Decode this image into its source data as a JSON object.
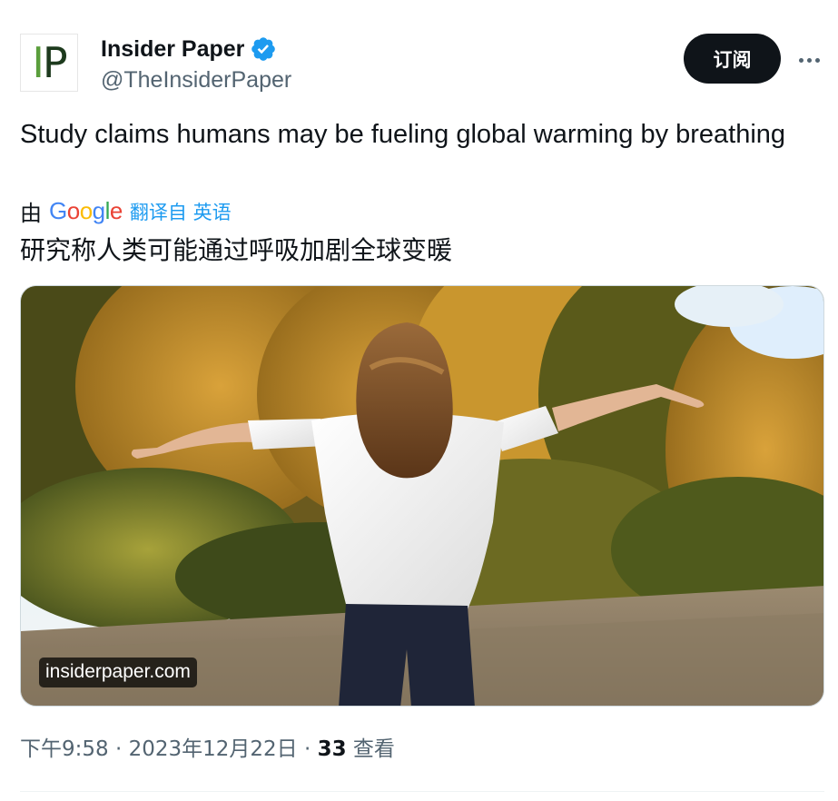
{
  "author": {
    "avatar_text": "IP",
    "display_name": "Insider Paper",
    "handle": "@TheInsiderPaper",
    "verified": true
  },
  "actions": {
    "subscribe_label": "订阅",
    "more_icon": "more-horizontal-icon"
  },
  "tweet": {
    "text": "Study claims humans may be fueling global warming by breathing",
    "translation": {
      "by_label": "由",
      "provider": "Google",
      "translated_from": "翻译自 英语",
      "text": "研究称人类可能通过呼吸加剧全球变暖"
    },
    "media": {
      "link_label": "insiderpaper.com",
      "alt": "Woman with outstretched arms in an autumn field"
    }
  },
  "meta": {
    "time": "下午9:58",
    "date": "2023年12月22日",
    "separator": " · ",
    "views_count": "33",
    "views_label": " 查看"
  },
  "colors": {
    "accent": "#1d9bf0",
    "text": "#0f1419",
    "secondary": "#536471",
    "button_bg": "#0f1419"
  }
}
